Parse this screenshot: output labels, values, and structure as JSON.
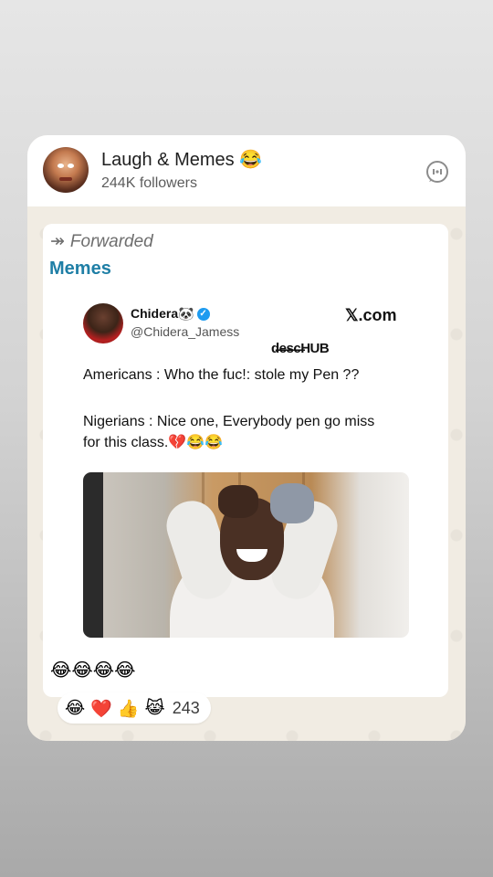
{
  "channel": {
    "name": "Laugh & Memes 😂",
    "followers": "244K followers",
    "avatar_icon": "cartoon-face-avatar"
  },
  "header_actions": {
    "icon": "channel-info-icon"
  },
  "message": {
    "forwarded_label": "Forwarded",
    "forward_icon": "↠",
    "sender": "Memes",
    "tweet": {
      "name": "Chidera🐼",
      "handle": "@Chidera_Jamess",
      "source": "𝕏.com",
      "watermark": "d̶e̶s̶c̶HUB",
      "line1": "Americans : Who the fuc!: stole my Pen ??",
      "line2": "Nigerians : Nice one, Everybody pen go miss for this class.💔😂😂"
    },
    "caption": "😂😂😂😂"
  },
  "reactions": {
    "emojis": [
      "😂",
      "❤️",
      "👍",
      "😹"
    ],
    "count": "243"
  },
  "colors": {
    "sender_color": "#1f7fa6",
    "verified_color": "#1d9bf0",
    "chat_background": "#f1ece3"
  }
}
